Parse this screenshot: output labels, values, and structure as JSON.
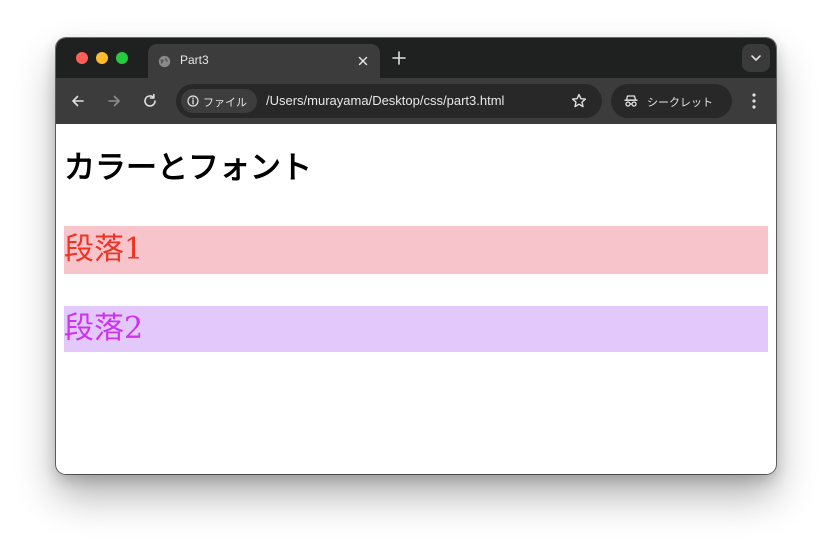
{
  "tab": {
    "title": "Part3"
  },
  "omnibox": {
    "chip_label": "ファイル",
    "url": "/Users/murayama/Desktop/css/part3.html"
  },
  "incognito": {
    "label": "シークレット"
  },
  "page": {
    "heading": "カラーとフォント",
    "paragraphs": [
      {
        "text": "段落1",
        "color": "#ee3322",
        "background": "#f7c4cc"
      },
      {
        "text": "段落2",
        "color": "#cc33ee",
        "background": "#e3c9fb"
      }
    ]
  },
  "colors": {
    "tabstrip": "#1f2020",
    "toolbar": "#3c3c3c",
    "omnibox": "#282828"
  },
  "icons": {
    "tab_favicon": "globe-icon",
    "tab_close": "close-icon",
    "new_tab": "plus-icon",
    "tab_search": "chevron-down-icon",
    "back": "arrow-left-icon",
    "forward": "arrow-right-icon",
    "reload": "reload-icon",
    "site_info": "info-icon",
    "bookmark": "star-icon",
    "incognito": "incognito-icon",
    "menu": "kebab-menu-icon"
  }
}
